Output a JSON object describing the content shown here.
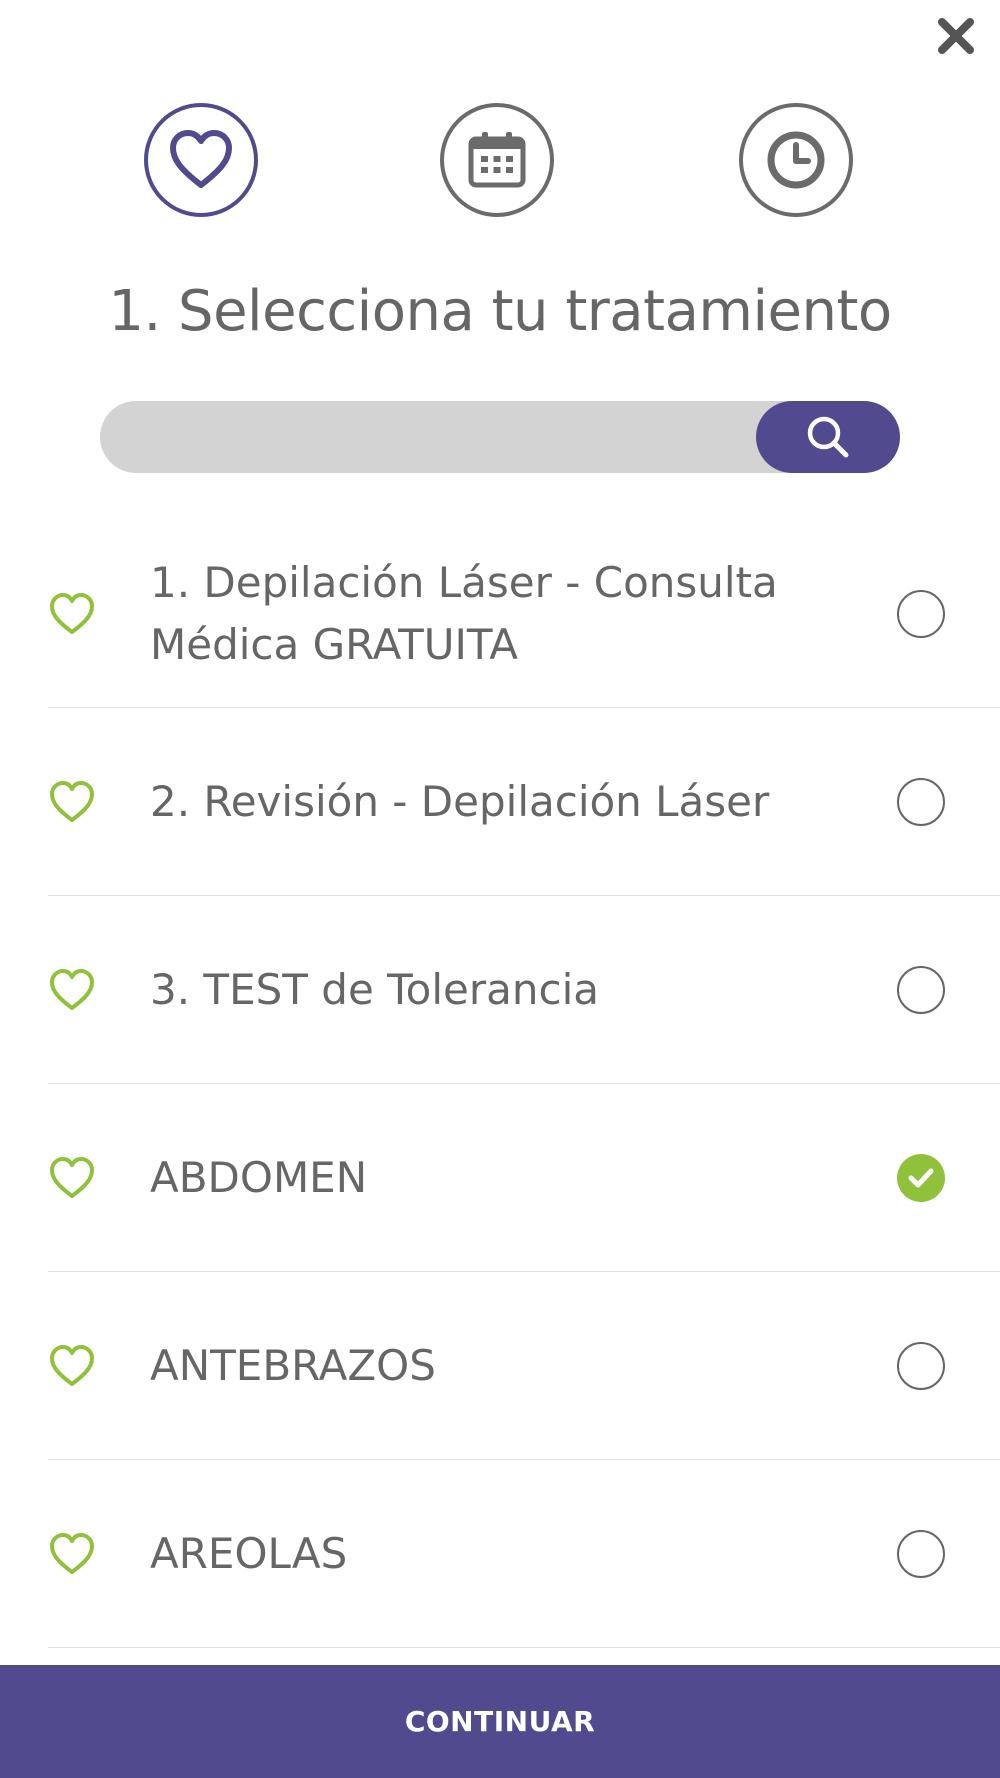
{
  "close": {
    "icon": "close-icon"
  },
  "steps": [
    {
      "icon": "heart-icon",
      "active": true
    },
    {
      "icon": "calendar-icon",
      "active": false
    },
    {
      "icon": "clock-icon",
      "active": false
    }
  ],
  "title": "1. Selecciona tu tratamiento",
  "search": {
    "value": "",
    "placeholder": "",
    "button_icon": "search-icon"
  },
  "treatments": [
    {
      "label": "1. Depilación Láser - Consulta Médica GRATUITA",
      "selected": false
    },
    {
      "label": "2. Revisión - Depilación Láser",
      "selected": false
    },
    {
      "label": "3. TEST de Tolerancia",
      "selected": false
    },
    {
      "label": "ABDOMEN",
      "selected": true
    },
    {
      "label": "ANTEBRAZOS",
      "selected": false
    },
    {
      "label": "AREOLAS",
      "selected": false
    }
  ],
  "continue_label": "CONTINUAR",
  "colors": {
    "primary": "#524a8e",
    "accent_green": "#8fc23a",
    "text": "#666666",
    "search_bg": "#d3d3d3"
  }
}
